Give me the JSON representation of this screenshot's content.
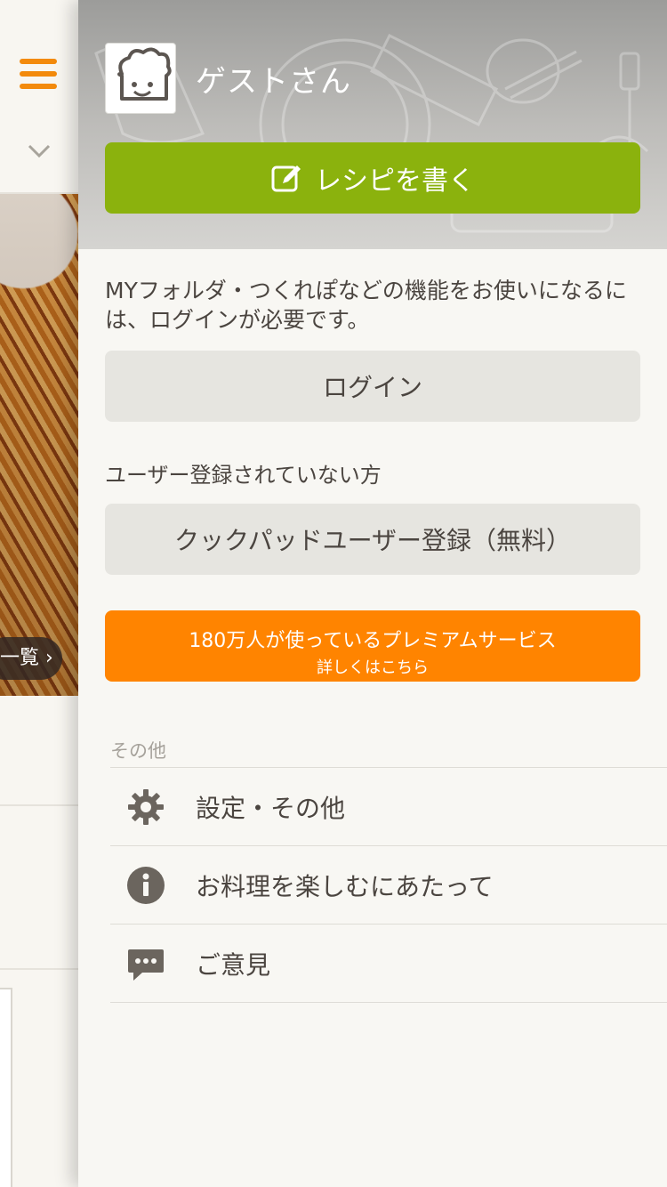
{
  "background": {
    "list_pill_label": "一覧"
  },
  "drawer": {
    "username": "ゲストさん",
    "write_recipe_label": "レシピを書く",
    "login_note": "MYフォルダ・つくれぽなどの機能をお使いになるには、ログインが必要です。",
    "login_label": "ログイン",
    "register_note": "ユーザー登録されていない方",
    "register_label": "クックパッドユーザー登録（無料）",
    "premium_main": "180万人が使っているプレミアムサービス",
    "premium_sub": "詳しくはこちら",
    "section_other": "その他",
    "menu": [
      {
        "label": "設定・その他",
        "icon": "gear-icon"
      },
      {
        "label": "お料理を楽しむにあたって",
        "icon": "info-icon"
      },
      {
        "label": "ご意見",
        "icon": "chat-icon"
      }
    ]
  },
  "colors": {
    "accent_orange": "#ff8400",
    "write_green": "#8bb20d",
    "text": "#4b4540"
  }
}
